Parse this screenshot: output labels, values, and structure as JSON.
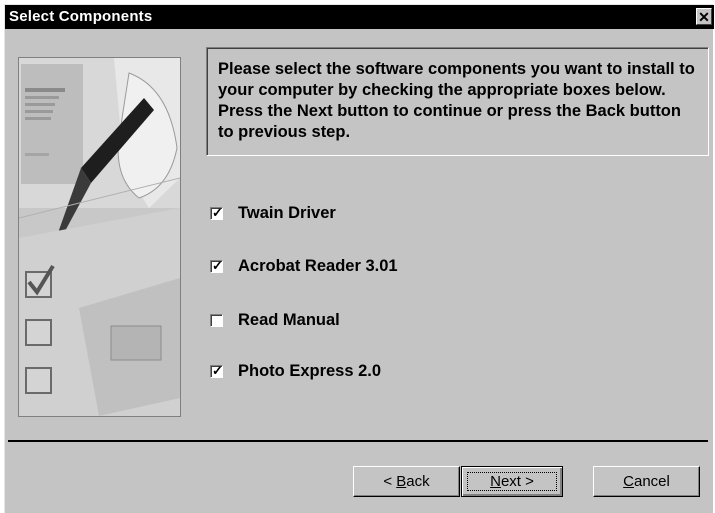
{
  "window": {
    "title": "Select Components",
    "close_glyph": "✕"
  },
  "instructions": "Please select the software components you want to install to your computer by checking the appropriate boxes below. Press the Next button to continue or press the Back button to previous step.",
  "components": [
    {
      "label": "Twain Driver",
      "checked": true
    },
    {
      "label": "Acrobat Reader 3.01",
      "checked": true
    },
    {
      "label": "Read Manual",
      "checked": false
    },
    {
      "label": "Photo Express 2.0",
      "checked": true
    }
  ],
  "buttons": {
    "back": {
      "prefix": "< ",
      "mnemonic": "B",
      "rest": "ack"
    },
    "next": {
      "mnemonic": "N",
      "rest": "ext",
      "suffix": " >"
    },
    "cancel": {
      "mnemonic": "C",
      "rest": "ancel"
    }
  },
  "icons": {
    "close": "close-icon",
    "side_image": "pen-and-checkboxes-illustration"
  },
  "colors": {
    "titlebar": "#000000",
    "dialog_background": "#c4c4c4"
  }
}
